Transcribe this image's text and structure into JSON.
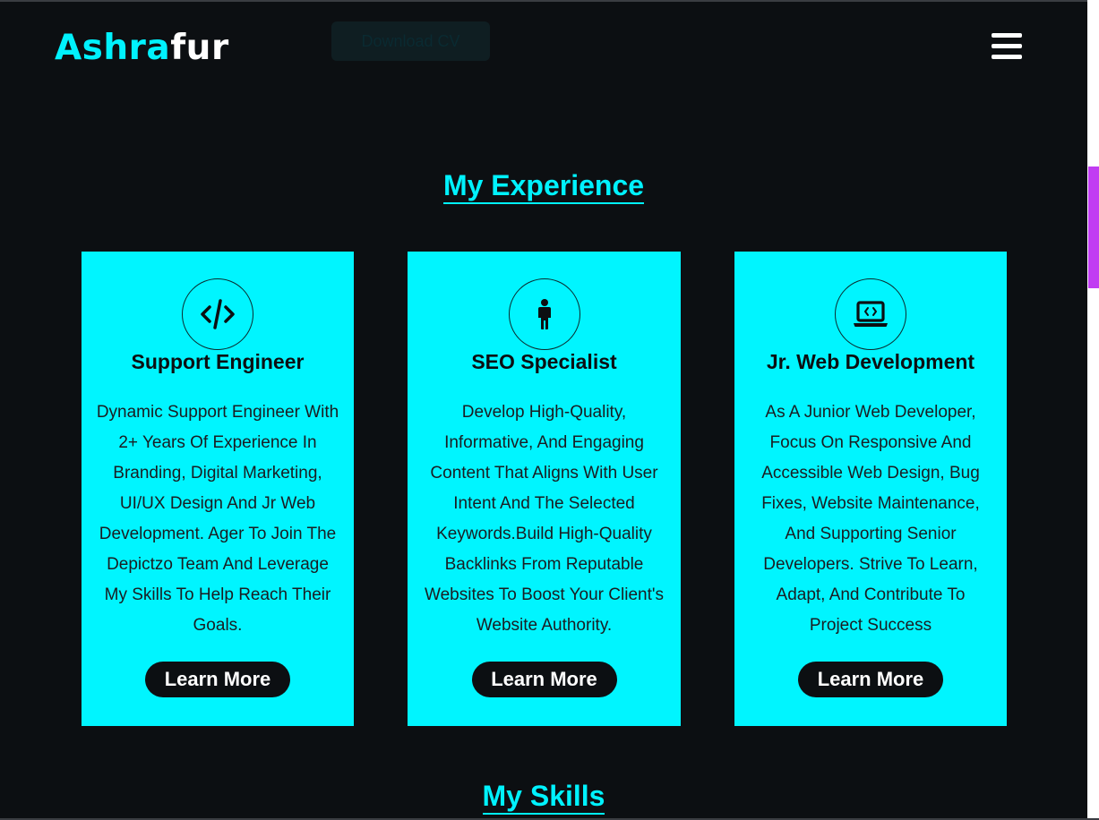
{
  "header": {
    "logo_part1": "Ashra",
    "logo_part2": "fur",
    "download_label": "Download CV",
    "menu_icon": "hamburger-menu-icon"
  },
  "experience": {
    "title": "My Experience",
    "cards": [
      {
        "icon": "code-icon",
        "title": "Support Engineer",
        "description": "Dynamic Support Engineer With 2+ Years Of Experience In Branding, Digital Marketing, UI/UX Design And Jr Web Development. Ager To Join The Depictzo Team And Leverage My Skills To Help Reach Their Goals.",
        "button": "Learn More"
      },
      {
        "icon": "person-icon",
        "title": "SEO Specialist",
        "description": "Develop High-Quality, Informative, And Engaging Content That Aligns With User Intent And The Selected Keywords.Build High-Quality Backlinks From Reputable Websites To Boost Your Client's Website Authority.",
        "button": "Learn More"
      },
      {
        "icon": "laptop-code-icon",
        "title": "Jr. Web Development",
        "description": "As A Junior Web Developer, Focus On Responsive And Accessible Web Design, Bug Fixes, Website Maintenance, And Supporting Senior Developers. Strive To Learn, Adapt, And Contribute To Project Success",
        "button": "Learn More"
      }
    ]
  },
  "skills": {
    "title": "My Skills"
  },
  "colors": {
    "background": "#0c0f12",
    "accent": "#00f2fe",
    "card": "#00f5ff",
    "scrollbar_thumb": "#c13cf2"
  }
}
